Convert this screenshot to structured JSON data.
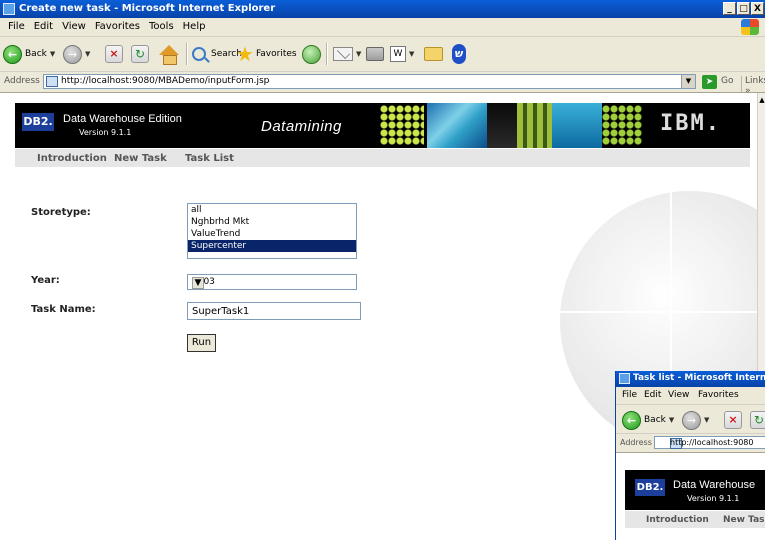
{
  "window": {
    "title": "Create new task - Microsoft Internet Explorer",
    "buttons": [
      "_",
      "□",
      "X"
    ]
  },
  "menu": [
    "File",
    "Edit",
    "View",
    "Favorites",
    "Tools",
    "Help"
  ],
  "toolbar": {
    "back": "Back",
    "search": "Search",
    "favorites": "Favorites"
  },
  "address": {
    "label": "Address",
    "url": "http://localhost:9080/MBADemo/inputForm.jsp",
    "go": "Go",
    "links": "Links »"
  },
  "banner": {
    "logo": "DB2.",
    "edition": "Data Warehouse Edition",
    "version": "Version 9.1.1",
    "product": "Datamining",
    "company": "IBM."
  },
  "nav": [
    "Introduction",
    "New Task",
    "Task List"
  ],
  "form": {
    "storetype_label": "Storetype:",
    "storetype_options": [
      "all",
      "Nghbrhd Mkt",
      "ValueTrend",
      "Supercenter"
    ],
    "storetype_selected": "Supercenter",
    "year_label": "Year:",
    "year_value": "2003",
    "taskname_label": "Task Name:",
    "taskname_value": "SuperTask1",
    "run_label": "Run"
  },
  "second_window": {
    "title": "Task list - Microsoft Internet",
    "menu": [
      "File",
      "Edit",
      "View",
      "Favorites"
    ],
    "back": "Back",
    "address_label": "Address",
    "url": "http://localhost:9080",
    "logo": "DB2.",
    "edition": "Data Warehouse",
    "version": "Version 9.1.1",
    "nav": [
      "Introduction",
      "New Tasl"
    ]
  },
  "colors": {
    "titlebar": "#0842a8",
    "selection": "#0a246a",
    "banner": "#000000",
    "db2_logo": "#1b3f9a"
  }
}
